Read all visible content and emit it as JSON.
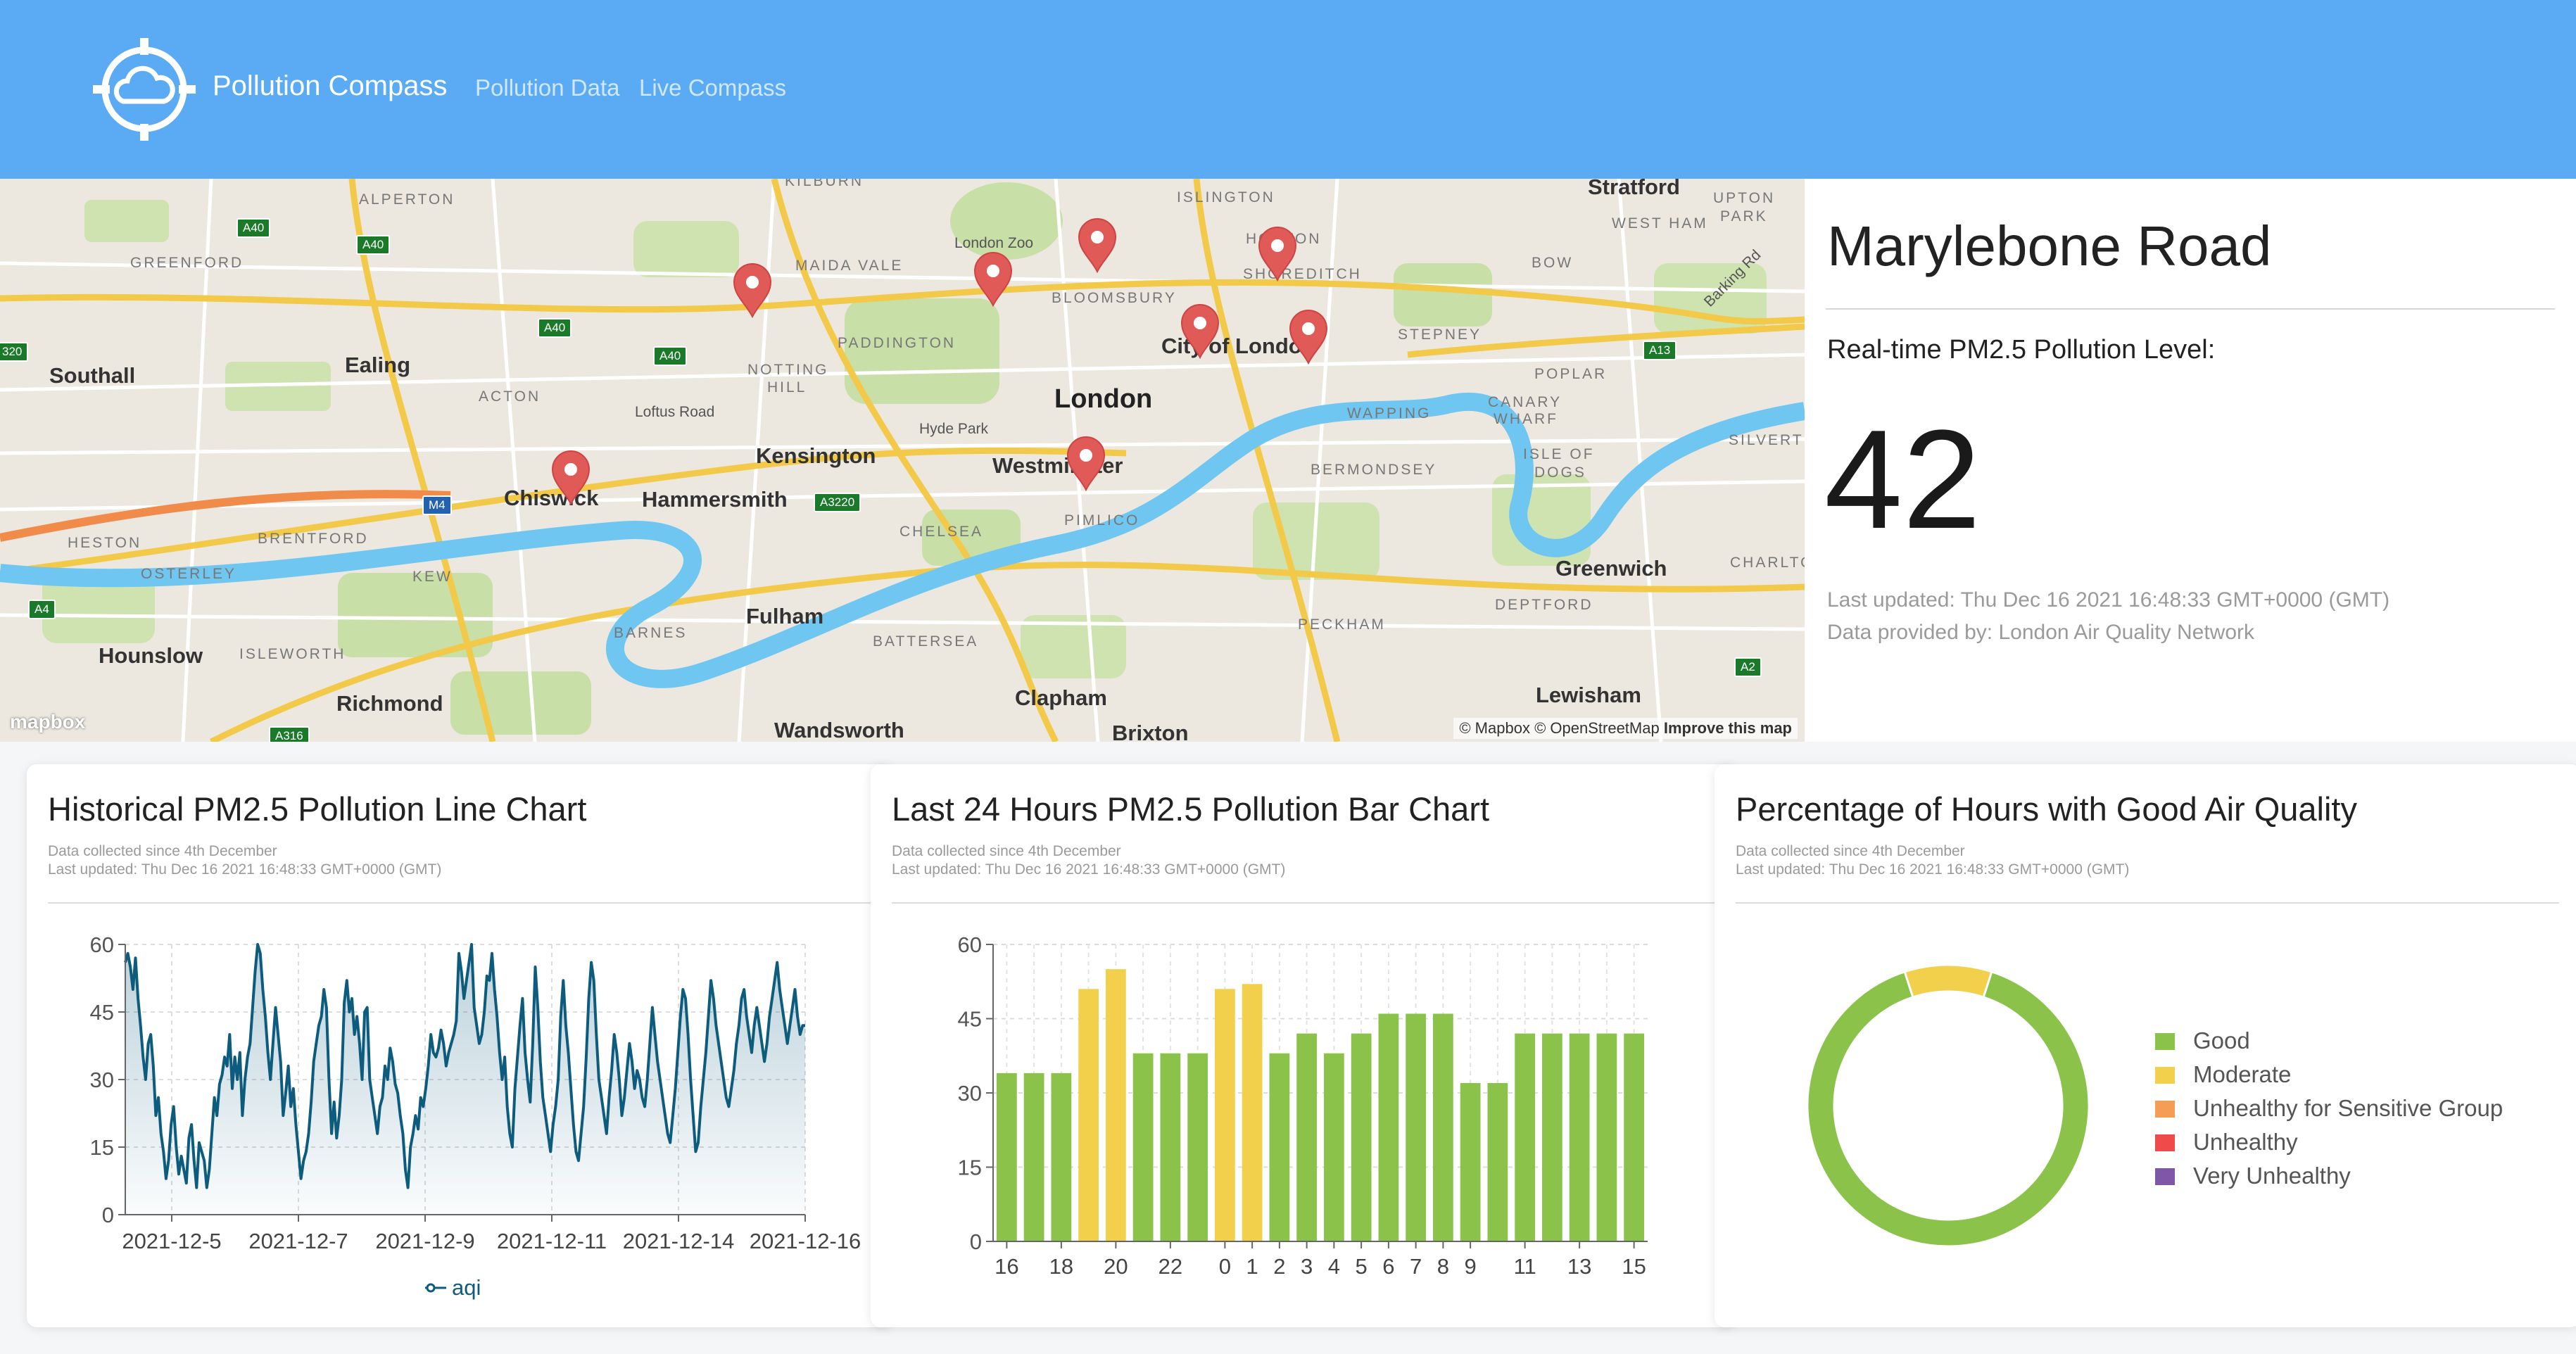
{
  "navbar": {
    "brand": "Pollution Compass",
    "links": [
      "Pollution Data",
      "Live Compass"
    ]
  },
  "map": {
    "labels": {
      "alperton": "ALPERTON",
      "greenford": "GREENFORD",
      "southall": "Southall",
      "ealing": "Ealing",
      "acton": "ACTON",
      "loftus": "Loftus Road",
      "notting": "NOTTING",
      "hill": "HILL",
      "maida": "MAIDA VALE",
      "paddington": "PADDINGTON",
      "zoo": "London Zoo",
      "bloomsbury": "BLOOMSBURY",
      "islington": "ISLINGTON",
      "hoxton": "HOXTON",
      "shoreditch": "SHOREDITCH",
      "city": "City of London",
      "london": "London",
      "hydepark": "Hyde Park",
      "kensington": "Kensington",
      "westminster": "Westminster",
      "chelsea": "CHELSEA",
      "pimlico": "PIMLICO",
      "chiswick": "Chiswick",
      "hammersmith": "Hammersmith",
      "brentford": "BRENTFORD",
      "kew": "KEW",
      "heston": "HESTON",
      "osterley": "OSTERLEY",
      "hounslow": "Hounslow",
      "isleworth": "ISLEWORTH",
      "richmond": "Richmond",
      "barnes": "BARNES",
      "fulham": "Fulham",
      "battersea": "BATTERSEA",
      "clapham": "Clapham",
      "brixton": "Brixton",
      "wandsworth": "Wandsworth",
      "bermondsey": "BERMONDSEY",
      "peckham": "PECKHAM",
      "wapping": "WAPPING",
      "stepney": "STEPNEY",
      "bow": "BOW",
      "westham": "WEST HAM",
      "upton": "UPTON",
      "park": "PARK",
      "stratford": "Stratford",
      "barking": "Barking Rd",
      "poplar": "POPLAR",
      "canary": "CANARY",
      "wharf": "WHARF",
      "isleof": "ISLE OF",
      "dogs": "DOGS",
      "silvert": "SILVERT",
      "greenwich": "Greenwich",
      "deptford": "DEPTFORD",
      "charlto": "CHARLTO",
      "lewisham": "Lewisham",
      "kilburn": "KILBURN"
    },
    "road_badges": {
      "a40a": "A40",
      "a40b": "A40",
      "a40c": "A40",
      "a40d": "A40",
      "a13": "A13",
      "a3220": "A3220",
      "m4": "M4",
      "a4": "A4",
      "a316": "A316",
      "a2": "A2",
      "m320": "320"
    },
    "attribution": {
      "mapbox": "© Mapbox",
      "osm": "© OpenStreetMap",
      "improve": "Improve this map"
    },
    "mapbox_logo": "mapbox"
  },
  "info": {
    "station": "Marylebone Road",
    "realtime_label": "Real-time PM2.5 Pollution Level:",
    "value": "42",
    "last_updated": "Last updated: Thu Dec 16 2021 16:48:33 GMT+0000 (GMT)",
    "provider": "Data provided by: London Air Quality Network"
  },
  "cards": [
    {
      "title": "Historical PM2.5 Pollution Line Chart",
      "sub1": "Data collected since 4th December",
      "sub2": "Last updated: Thu Dec 16 2021 16:48:33 GMT+0000 (GMT)"
    },
    {
      "title": "Last 24 Hours PM2.5 Pollution Bar Chart",
      "sub1": "Data collected since 4th December",
      "sub2": "Last updated: Thu Dec 16 2021 16:48:33 GMT+0000 (GMT)"
    },
    {
      "title": "Percentage of Hours with Good Air Quality",
      "sub1": "Data collected since 4th December",
      "sub2": "Last updated: Thu Dec 16 2021 16:48:33 GMT+0000 (GMT)"
    }
  ],
  "colors": {
    "navbar": "#5aabf3",
    "good": "#8bc34a",
    "moderate": "#f2d04b",
    "sensitive": "#f59d55",
    "unhealthy": "#ef4b4b",
    "very_unhealthy": "#7e57a8",
    "line": "#0d5c7e",
    "pin": "#e05a57"
  },
  "chart_data": [
    {
      "type": "line",
      "title": "Historical PM2.5 Pollution Line Chart",
      "y_ticks": [
        "0",
        "15",
        "30",
        "45",
        "60"
      ],
      "ylim": [
        0,
        60
      ],
      "x_tick_labels": [
        "2021-12-5",
        "2021-12-7",
        "2021-12-9",
        "2021-12-11",
        "2021-12-14",
        "2021-12-16"
      ],
      "legend": "aqi",
      "series": [
        {
          "name": "aqi",
          "values": [
            56,
            58,
            55,
            50,
            57,
            48,
            42,
            35,
            30,
            38,
            40,
            33,
            22,
            26,
            18,
            14,
            8,
            12,
            20,
            24,
            15,
            9,
            13,
            10,
            7,
            17,
            20,
            12,
            6,
            16,
            14,
            12,
            6,
            10,
            18,
            26,
            22,
            29,
            31,
            35,
            33,
            40,
            28,
            35,
            30,
            36,
            22,
            30,
            35,
            38,
            46,
            54,
            60,
            58,
            50,
            44,
            36,
            30,
            38,
            46,
            40,
            34,
            22,
            27,
            33,
            24,
            28,
            20,
            14,
            8,
            12,
            14,
            18,
            25,
            34,
            38,
            42,
            44,
            50,
            46,
            30,
            18,
            25,
            17,
            22,
            30,
            47,
            52,
            45,
            48,
            40,
            44,
            38,
            30,
            45,
            46,
            30,
            26,
            22,
            18,
            24,
            26,
            33,
            30,
            37,
            34,
            29,
            27,
            22,
            18,
            10,
            6,
            15,
            18,
            22,
            19,
            26,
            24,
            28,
            33,
            40,
            36,
            35,
            37,
            41,
            38,
            33,
            36,
            38,
            40,
            43,
            58,
            54,
            48,
            52,
            56,
            60,
            46,
            42,
            38,
            40,
            45,
            53,
            52,
            58,
            50,
            44,
            36,
            30,
            35,
            24,
            18,
            15,
            28,
            35,
            42,
            48,
            36,
            30,
            25,
            38,
            55,
            46,
            34,
            26,
            22,
            18,
            14,
            20,
            24,
            30,
            44,
            52,
            42,
            36,
            28,
            20,
            14,
            12,
            18,
            24,
            35,
            48,
            56,
            52,
            40,
            30,
            26,
            22,
            18,
            26,
            32,
            40,
            36,
            30,
            22,
            26,
            32,
            38,
            34,
            28,
            32,
            30,
            26,
            24,
            30,
            38,
            46,
            40,
            34,
            30,
            26,
            22,
            18,
            16,
            22,
            28,
            36,
            44,
            50,
            48,
            40,
            30,
            22,
            14,
            16,
            24,
            30,
            36,
            44,
            52,
            48,
            42,
            38,
            34,
            30,
            26,
            24,
            28,
            32,
            38,
            42,
            48,
            50,
            44,
            40,
            36,
            42,
            46,
            42,
            38,
            34,
            38,
            44,
            48,
            52,
            56,
            50,
            46,
            42,
            38,
            42,
            46,
            50,
            44,
            40,
            42,
            42
          ]
        }
      ]
    },
    {
      "type": "bar",
      "title": "Last 24 Hours PM2.5 Pollution Bar Chart",
      "y_ticks": [
        "0",
        "15",
        "30",
        "45",
        "60"
      ],
      "ylim": [
        0,
        60
      ],
      "categories": [
        "16",
        "17",
        "18",
        "19",
        "20",
        "21",
        "22",
        "23",
        "0",
        "1",
        "2",
        "3",
        "4",
        "5",
        "6",
        "7",
        "8",
        "9",
        "10",
        "11",
        "12",
        "13",
        "14",
        "15"
      ],
      "x_tick_labels": [
        "16",
        "18",
        "20",
        "22",
        "0",
        "1",
        "2",
        "3",
        "4",
        "5",
        "6",
        "7",
        "8",
        "9",
        "11",
        "13",
        "15"
      ],
      "values": [
        34,
        34,
        34,
        51,
        55,
        38,
        38,
        38,
        51,
        52,
        38,
        42,
        38,
        42,
        46,
        46,
        46,
        32,
        32,
        42,
        42,
        42,
        42,
        42
      ],
      "bar_levels": [
        "good",
        "good",
        "good",
        "moderate",
        "moderate",
        "good",
        "good",
        "good",
        "moderate",
        "moderate",
        "good",
        "good",
        "good",
        "good",
        "good",
        "good",
        "good",
        "good",
        "good",
        "good",
        "good",
        "good",
        "good",
        "good"
      ]
    },
    {
      "type": "pie",
      "title": "Percentage of Hours with Good Air Quality",
      "labels": [
        "Good",
        "Moderate",
        "Unhealthy for Sensitive Group",
        "Unhealthy",
        "Very Unhealthy"
      ],
      "values": [
        90,
        10,
        0,
        0,
        0
      ],
      "colors": [
        "#8bc34a",
        "#f2d04b",
        "#f59d55",
        "#ef4b4b",
        "#7e57a8"
      ],
      "legend_position": "right"
    }
  ]
}
